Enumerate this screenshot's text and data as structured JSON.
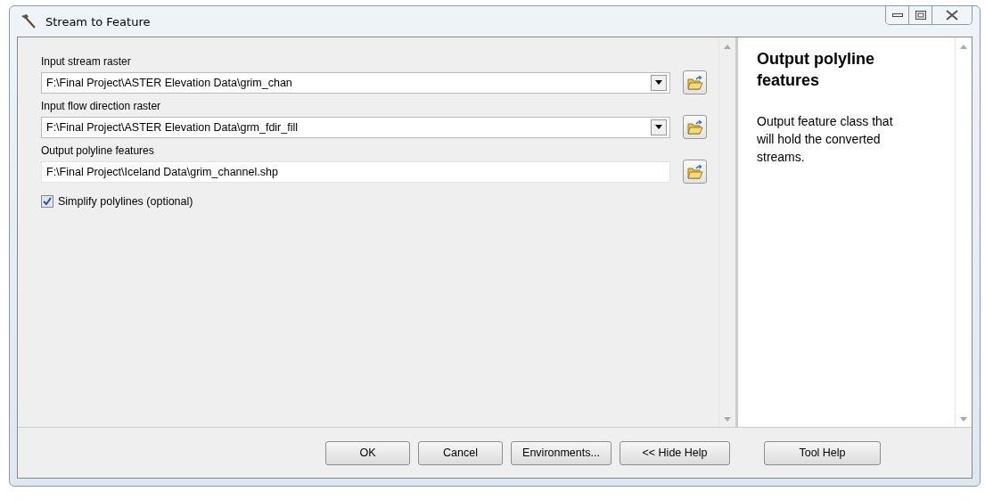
{
  "window": {
    "title": "Stream to Feature"
  },
  "fields": [
    {
      "label": "Input stream raster",
      "value": "F:\\Final Project\\ASTER Elevation Data\\grim_chan",
      "kind": "combo"
    },
    {
      "label": "Input flow direction raster",
      "value": "F:\\Final Project\\ASTER Elevation Data\\grm_fdir_fill",
      "kind": "combo"
    },
    {
      "label": "Output polyline features",
      "value": "F:\\Final Project\\Iceland Data\\grim_channel.shp",
      "kind": "text"
    }
  ],
  "option": {
    "label": "Simplify polylines (optional)",
    "checked": true
  },
  "help": {
    "title": "Output polyline features",
    "text": "Output feature class that will hold the converted streams."
  },
  "buttons": [
    "OK",
    "Cancel",
    "Environments...",
    "<< Hide Help"
  ],
  "help_button": "Tool Help"
}
